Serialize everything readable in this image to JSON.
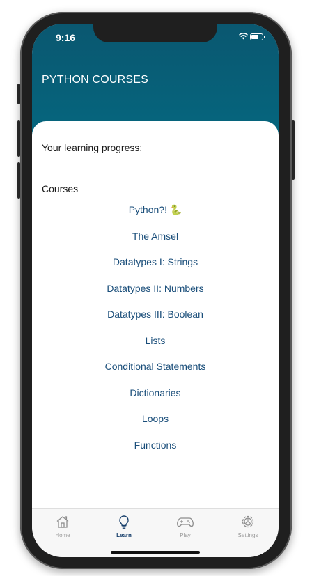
{
  "status_bar": {
    "time": "9:16",
    "signal_dots": "....."
  },
  "header": {
    "title": "PYTHON COURSES"
  },
  "progress": {
    "label": "Your learning progress:"
  },
  "courses": {
    "label": "Courses",
    "items": [
      {
        "label": "Python?! 🐍"
      },
      {
        "label": "The Amsel"
      },
      {
        "label": "Datatypes I: Strings"
      },
      {
        "label": "Datatypes II: Numbers"
      },
      {
        "label": "Datatypes III: Boolean"
      },
      {
        "label": "Lists"
      },
      {
        "label": "Conditional Statements"
      },
      {
        "label": "Dictionaries"
      },
      {
        "label": "Loops"
      },
      {
        "label": "Functions"
      }
    ]
  },
  "tabbar": {
    "tabs": [
      {
        "label": "Home",
        "icon": "home-icon"
      },
      {
        "label": "Learn",
        "icon": "lightbulb-icon",
        "active": true
      },
      {
        "label": "Play",
        "icon": "gamepad-icon"
      },
      {
        "label": "Settings",
        "icon": "gear-icon"
      }
    ]
  },
  "colors": {
    "header": "#0a5770",
    "course_text": "#1a4e7a",
    "active_tab": "#163e6a",
    "inactive_tab": "#9a9a9a"
  }
}
